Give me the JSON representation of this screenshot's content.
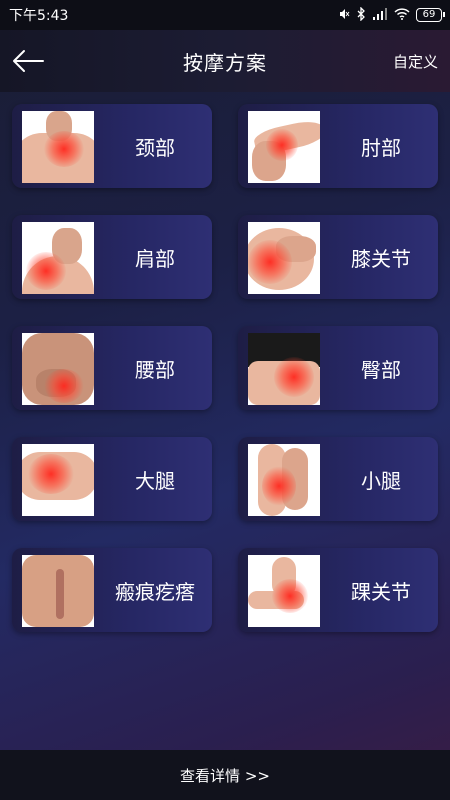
{
  "status_bar": {
    "time": "下午5:43",
    "battery": "69"
  },
  "header": {
    "title": "按摩方案",
    "custom_label": "自定义"
  },
  "items": [
    {
      "label": "颈部"
    },
    {
      "label": "肘部"
    },
    {
      "label": "肩部"
    },
    {
      "label": "膝关节"
    },
    {
      "label": "腰部"
    },
    {
      "label": "臀部"
    },
    {
      "label": "大腿"
    },
    {
      "label": "小腿"
    },
    {
      "label": "瘢痕疙瘩"
    },
    {
      "label": "踝关节"
    }
  ],
  "footer": {
    "details_label": "查看详情 >>"
  }
}
